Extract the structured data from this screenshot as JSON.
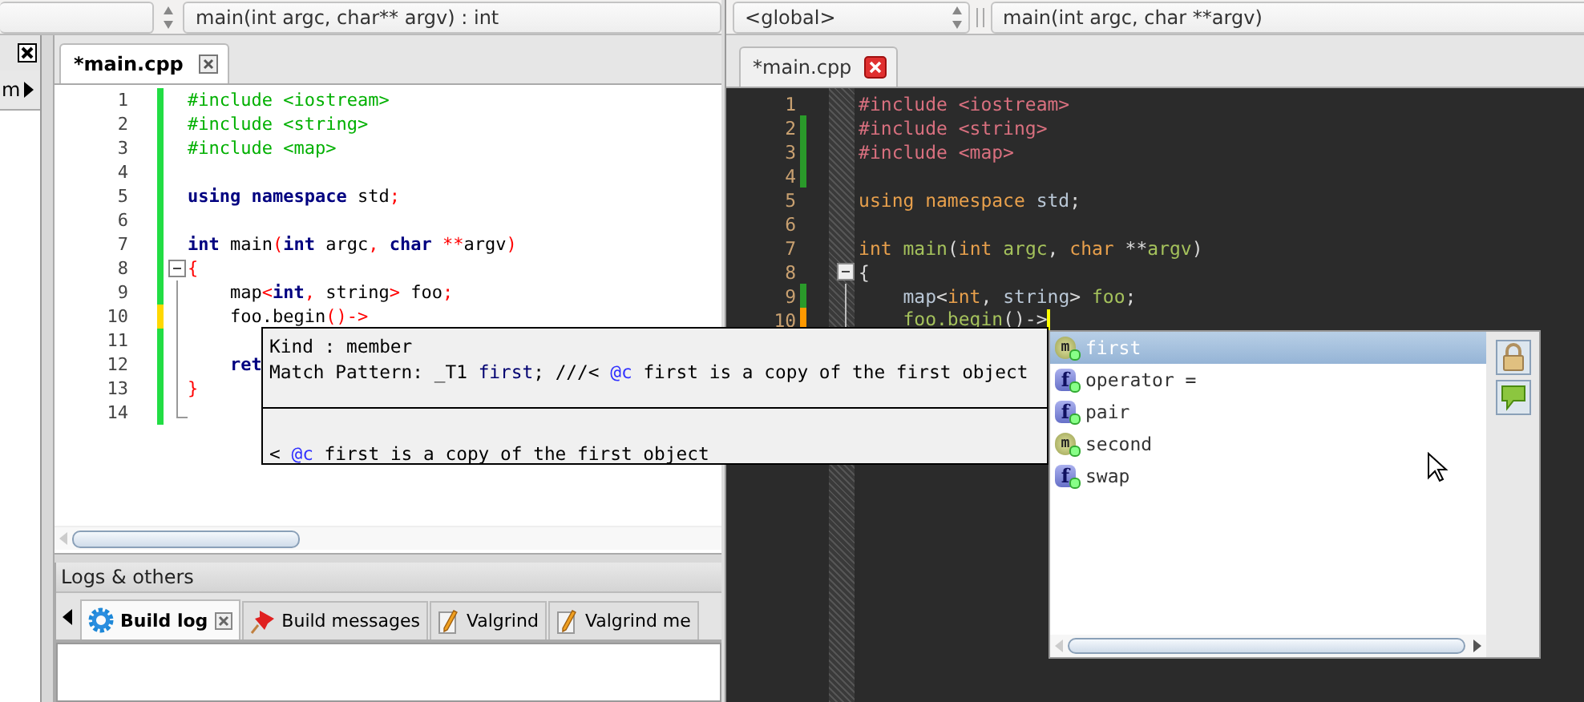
{
  "left": {
    "toolbar": {
      "function": "main(int argc, char** argv) : int"
    },
    "side_panel": {
      "tab": "m"
    },
    "file_tab": {
      "label": "*main.cpp",
      "selected": true
    },
    "lines": [
      {
        "number": "1",
        "changed": true,
        "saved": true,
        "tokens": [
          {
            "kind": "pp",
            "text": "#include <iostream>"
          }
        ]
      },
      {
        "number": "2",
        "changed": true,
        "saved": true,
        "tokens": [
          {
            "kind": "pp",
            "text": "#include <string>"
          }
        ]
      },
      {
        "number": "3",
        "changed": true,
        "saved": true,
        "tokens": [
          {
            "kind": "pp",
            "text": "#include <map>"
          }
        ]
      },
      {
        "number": "4",
        "changed": true,
        "saved": true
      },
      {
        "number": "5",
        "changed": true,
        "saved": true,
        "tokens": [
          {
            "kind": "kw",
            "text": "using namespace"
          },
          {
            "kind": "id",
            "text": " std"
          },
          {
            "kind": "op",
            "text": ";"
          }
        ]
      },
      {
        "number": "6",
        "changed": true,
        "saved": true
      },
      {
        "number": "7",
        "changed": true,
        "saved": true,
        "tokens": [
          {
            "kind": "kw",
            "text": "int"
          },
          {
            "kind": "name",
            "text": " main"
          },
          {
            "kind": "op",
            "text": "("
          },
          {
            "kind": "kw",
            "text": "int"
          },
          {
            "kind": "name",
            "text": " argc"
          },
          {
            "kind": "op",
            "text": ", "
          },
          {
            "kind": "kw",
            "text": "char"
          },
          {
            "kind": "op",
            "text": " **"
          },
          {
            "kind": "name",
            "text": "argv"
          },
          {
            "kind": "op",
            "text": ")"
          }
        ]
      },
      {
        "number": "8",
        "changed": true,
        "saved": true,
        "fold": {
          "kind": "start"
        },
        "tokens": [
          {
            "kind": "op",
            "text": "{"
          }
        ]
      },
      {
        "number": "9",
        "changed": true,
        "saved": true,
        "fold": {
          "kind": "line"
        },
        "tokens": [
          {
            "kind": "id",
            "text": "    map"
          },
          {
            "kind": "op",
            "text": "<"
          },
          {
            "kind": "kw",
            "text": "int"
          },
          {
            "kind": "op",
            "text": ","
          },
          {
            "kind": "id",
            "text": " string"
          },
          {
            "kind": "op",
            "text": ">"
          },
          {
            "kind": "name",
            "text": " foo"
          },
          {
            "kind": "op",
            "text": ";"
          }
        ]
      },
      {
        "number": "10",
        "changed": true,
        "saved": false,
        "fold": {
          "kind": "line"
        },
        "tokens": [
          {
            "kind": "name",
            "text": "    foo.begin"
          },
          {
            "kind": "op",
            "text": "()->"
          }
        ]
      },
      {
        "number": "11",
        "changed": true,
        "saved": true,
        "fold": {
          "kind": "line"
        }
      },
      {
        "number": "12",
        "changed": true,
        "saved": true,
        "fold": {
          "kind": "line"
        },
        "tokens": [
          {
            "kind": "kw",
            "text": "    ret"
          }
        ]
      },
      {
        "number": "13",
        "changed": true,
        "saved": true,
        "fold": {
          "kind": "line"
        },
        "tokens": [
          {
            "kind": "op",
            "text": "}"
          }
        ]
      },
      {
        "number": "14",
        "changed": true,
        "saved": true,
        "fold": {
          "kind": "end"
        }
      }
    ],
    "logs": {
      "title": "Logs & others",
      "tabs": [
        {
          "label": "Build log",
          "kind": "gear",
          "selected": true,
          "closable": true
        },
        {
          "label": "Build messages",
          "kind": "pin",
          "selected": false,
          "closable": false
        },
        {
          "label": "Valgrind",
          "kind": "pencil",
          "selected": false,
          "closable": false
        },
        {
          "label": "Valgrind me",
          "kind": "pencil",
          "selected": false,
          "closable": false
        }
      ]
    }
  },
  "right": {
    "toolbar": {
      "scope": "<global>",
      "function": "main(int argc, char **argv)"
    },
    "file_tab": {
      "label": "*main.cpp",
      "selected": true
    },
    "lines": [
      {
        "number": "1",
        "changed": false,
        "caret": false,
        "tokens": [
          {
            "kind": "pp",
            "text": "#include <iostream>"
          }
        ]
      },
      {
        "number": "2",
        "changed": true,
        "saved": true,
        "caret": false,
        "tokens": [
          {
            "kind": "pp",
            "text": "#include <string>"
          }
        ]
      },
      {
        "number": "3",
        "changed": true,
        "saved": true,
        "caret": false,
        "tokens": [
          {
            "kind": "pp",
            "text": "#include <map>"
          }
        ]
      },
      {
        "number": "4",
        "changed": true,
        "saved": true,
        "caret": false
      },
      {
        "number": "5",
        "changed": false,
        "caret": false,
        "tokens": [
          {
            "kind": "kw",
            "text": "using namespace"
          },
          {
            "kind": "id",
            "text": " std"
          },
          {
            "kind": "op",
            "text": ";"
          }
        ]
      },
      {
        "number": "6",
        "changed": false,
        "caret": false
      },
      {
        "number": "7",
        "changed": false,
        "caret": false,
        "tokens": [
          {
            "kind": "kw",
            "text": "int"
          },
          {
            "kind": "name",
            "text": " main"
          },
          {
            "kind": "op",
            "text": "("
          },
          {
            "kind": "kw",
            "text": "int"
          },
          {
            "kind": "name",
            "text": " argc"
          },
          {
            "kind": "op",
            "text": ", "
          },
          {
            "kind": "kw",
            "text": "char"
          },
          {
            "kind": "op",
            "text": " **"
          },
          {
            "kind": "name",
            "text": "argv"
          },
          {
            "kind": "op",
            "text": ")"
          }
        ]
      },
      {
        "number": "8",
        "changed": false,
        "caret": false,
        "fold": {
          "kind": "start"
        },
        "tokens": [
          {
            "kind": "op",
            "text": "{"
          }
        ]
      },
      {
        "number": "9",
        "changed": true,
        "saved": true,
        "caret": false,
        "fold": {
          "kind": "line"
        },
        "tokens": [
          {
            "kind": "id",
            "text": "    map"
          },
          {
            "kind": "op",
            "text": "<"
          },
          {
            "kind": "kw",
            "text": "int"
          },
          {
            "kind": "op",
            "text": ", "
          },
          {
            "kind": "id",
            "text": "string"
          },
          {
            "kind": "op",
            "text": "> "
          },
          {
            "kind": "name",
            "text": "foo"
          },
          {
            "kind": "op",
            "text": ";"
          }
        ]
      },
      {
        "number": "10",
        "changed": true,
        "saved": false,
        "caret": true,
        "fold": {
          "kind": "line"
        },
        "tokens": [
          {
            "kind": "name",
            "text": "    foo.begin"
          },
          {
            "kind": "op",
            "text": "()->"
          }
        ]
      }
    ]
  },
  "tooltip": {
    "sections": [
      {
        "lines": [
          [
            {
              "kind": "plain",
              "text": "Kind : member"
            }
          ],
          [
            {
              "kind": "plain",
              "text": "Match Pattern: _T1 "
            },
            {
              "kind": "ident",
              "text": "first"
            },
            {
              "kind": "plain",
              "text": "; ///< "
            },
            {
              "kind": "tag",
              "text": "@c"
            },
            {
              "kind": "plain",
              "text": " first is a copy of the first object"
            }
          ]
        ]
      },
      {
        "lines": [
          [
            {
              "kind": "plain",
              "text": "< "
            },
            {
              "kind": "tag",
              "text": "@c"
            },
            {
              "kind": "plain",
              "text": " first is a copy of the first object"
            }
          ]
        ]
      }
    ]
  },
  "completion": {
    "items": [
      {
        "label": "first",
        "badge": "m",
        "kind": "member",
        "selected": true
      },
      {
        "label": "operator =",
        "badge": "f",
        "kind": "function",
        "selected": false
      },
      {
        "label": "pair",
        "badge": "f",
        "kind": "function",
        "selected": false
      },
      {
        "label": "second",
        "badge": "m",
        "kind": "member",
        "selected": false
      },
      {
        "label": "swap",
        "badge": "f",
        "kind": "function",
        "selected": false
      }
    ]
  }
}
